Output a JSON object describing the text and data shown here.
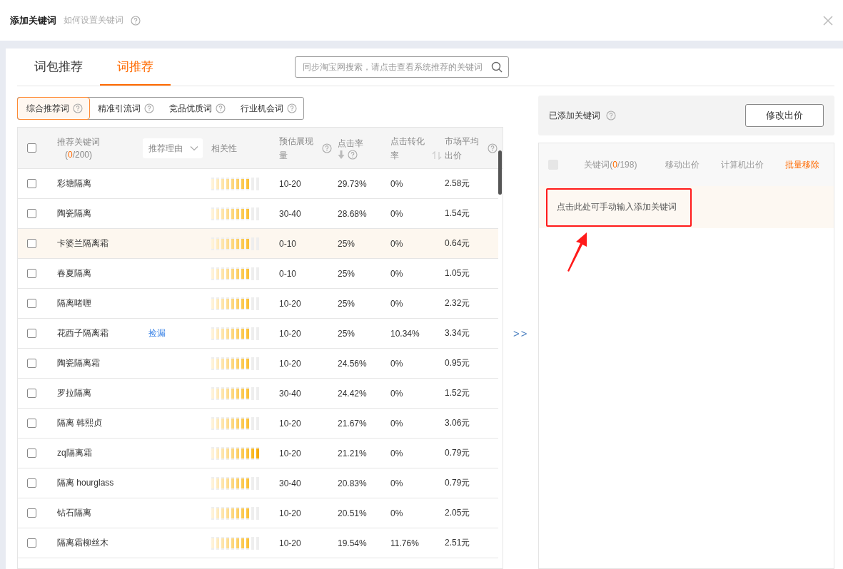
{
  "dialog": {
    "title": "添加关键词",
    "help_link": "如何设置关键词"
  },
  "tabs": [
    {
      "label": "词包推荐",
      "selected": false
    },
    {
      "label": "词推荐",
      "selected": true
    }
  ],
  "search": {
    "placeholder": "同步淘宝网搜索，请点击查看系统推荐的关键词"
  },
  "filters": [
    {
      "label": "综合推荐词",
      "selected": true
    },
    {
      "label": "精准引流词",
      "selected": false
    },
    {
      "label": "竞品优质词",
      "selected": false
    },
    {
      "label": "行业机会词",
      "selected": false
    }
  ],
  "table": {
    "select_all": {
      "checked": false
    },
    "columns": [
      {
        "kind": "keyword",
        "label": "推荐关键词",
        "count_parts": [
          {
            "text": "(",
            "accent": false
          },
          {
            "text": "0",
            "accent": true
          },
          {
            "text": "/200)",
            "accent": false
          }
        ]
      },
      {
        "kind": "dropdown",
        "label": "推荐理由"
      },
      {
        "kind": "plain",
        "label": "相关性"
      },
      {
        "kind": "help",
        "label": "预估展现量"
      },
      {
        "kind": "sort_down_help",
        "label": "点击率"
      },
      {
        "kind": "sort",
        "label": "点击转化率"
      },
      {
        "kind": "help",
        "label": "市场平均出价"
      }
    ],
    "rows": [
      {
        "keyword": "彩塘隔离",
        "level": 0.8,
        "impressions": "10-20",
        "ctr": "29.73%",
        "cvr": "0%",
        "price": "2.58元",
        "checked": false,
        "highlighted": false
      },
      {
        "keyword": "陶瓷隔离",
        "level": 0.8,
        "impressions": "30-40",
        "ctr": "28.68%",
        "cvr": "0%",
        "price": "1.54元",
        "checked": false,
        "highlighted": false
      },
      {
        "keyword": "卡婆兰隔离霜",
        "level": 0.8,
        "impressions": "0-10",
        "ctr": "25%",
        "cvr": "0%",
        "price": "0.64元",
        "checked": false,
        "highlighted": true
      },
      {
        "keyword": "春夏隔离",
        "level": 0.8,
        "impressions": "0-10",
        "ctr": "25%",
        "cvr": "0%",
        "price": "1.05元",
        "checked": false,
        "highlighted": false
      },
      {
        "keyword": "隔离啫喱",
        "level": 0.8,
        "impressions": "10-20",
        "ctr": "25%",
        "cvr": "0%",
        "price": "2.32元",
        "checked": false,
        "highlighted": false
      },
      {
        "keyword": "花西子隔离霜",
        "reason": "捡漏",
        "level": 0.8,
        "impressions": "10-20",
        "ctr": "25%",
        "cvr": "10.34%",
        "price": "3.34元",
        "checked": false,
        "highlighted": false
      },
      {
        "keyword": "陶瓷隔离霜",
        "level": 0.8,
        "impressions": "10-20",
        "ctr": "24.56%",
        "cvr": "0%",
        "price": "0.95元",
        "checked": false,
        "highlighted": false
      },
      {
        "keyword": "罗拉隔离",
        "level": 0.8,
        "impressions": "30-40",
        "ctr": "24.42%",
        "cvr": "0%",
        "price": "1.52元",
        "checked": false,
        "highlighted": false
      },
      {
        "keyword": "隔离 韩熙贞",
        "level": 0.8,
        "impressions": "10-20",
        "ctr": "21.67%",
        "cvr": "0%",
        "price": "3.06元",
        "checked": false,
        "highlighted": false
      },
      {
        "keyword": "zq隔离霜",
        "level": 1,
        "impressions": "10-20",
        "ctr": "21.21%",
        "cvr": "0%",
        "price": "0.79元",
        "checked": false,
        "highlighted": false
      },
      {
        "keyword": "隔离 hourglass",
        "level": 0.8,
        "impressions": "30-40",
        "ctr": "20.83%",
        "cvr": "0%",
        "price": "0.79元",
        "checked": false,
        "highlighted": false
      },
      {
        "keyword": "钻石隔离",
        "level": 0.8,
        "impressions": "10-20",
        "ctr": "20.51%",
        "cvr": "0%",
        "price": "2.05元",
        "checked": false,
        "highlighted": false
      },
      {
        "keyword": "隔离霜柳丝木",
        "level": 0.8,
        "impressions": "10-20",
        "ctr": "19.54%",
        "cvr": "11.76%",
        "price": "2.51元",
        "checked": false,
        "highlighted": false
      }
    ]
  },
  "transfer_button": ">>",
  "added": {
    "title": "已添加关键词",
    "button": "修改出价",
    "select_all": {
      "disabled": true
    },
    "columns": [
      {
        "kind": "count",
        "parts": [
          {
            "text": "关键词(",
            "accent": false
          },
          {
            "text": "0",
            "accent": true
          },
          {
            "text": "/198)",
            "accent": false
          }
        ]
      },
      {
        "kind": "plain",
        "label": "移动出价"
      },
      {
        "kind": "plain",
        "label": "计算机出价"
      },
      {
        "kind": "action",
        "label": "批量移除"
      }
    ],
    "manual_entry": "点击此处可手动输入添加关键词"
  }
}
